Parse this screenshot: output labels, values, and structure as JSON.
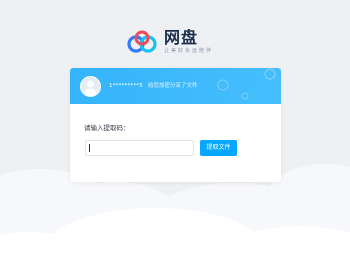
{
  "brand": {
    "title": "网盘",
    "slogan": "让美好永远陪伴"
  },
  "share": {
    "user": "1*********5",
    "message": "给您加密分享了文件"
  },
  "form": {
    "prompt": "请输入提取码：",
    "code_value": "",
    "button_label": "提取文件"
  },
  "colors": {
    "accent": "#06a7ff",
    "header": "#3cb8fc",
    "background": "#eef0f4"
  },
  "icons": {
    "logo": "cloud-logo-icon",
    "avatar": "default-user-avatar-icon"
  }
}
